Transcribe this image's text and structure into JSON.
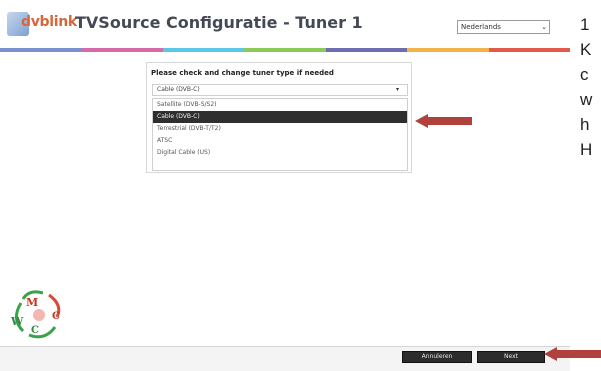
{
  "header": {
    "logo_text": "dvblink",
    "title": "TVSource Configuratie - Tuner 1",
    "language_selected": "Nederlands",
    "color_bar": [
      "#7c8fd0",
      "#d66aa8",
      "#5ac7e8",
      "#8ccb57",
      "#6d6db0",
      "#f1b34a",
      "#e35a4b"
    ]
  },
  "panel": {
    "title": "Please check and change tuner type if needed",
    "selected_value": "Cable (DVB-C)",
    "options": [
      "Satellite (DVB-S/S2)",
      "Cable (DVB-C)",
      "Terrestrial (DVB-T/T2)",
      "ATSC",
      "Digital Cable (US)"
    ],
    "highlighted_index": 1
  },
  "footer": {
    "cancel_label": "Annuleren",
    "next_label": "Next"
  },
  "annotation": {
    "arrow_color": "#b0413c"
  },
  "side_text": [
    "1",
    "K",
    "c",
    "w",
    "h",
    "H"
  ]
}
